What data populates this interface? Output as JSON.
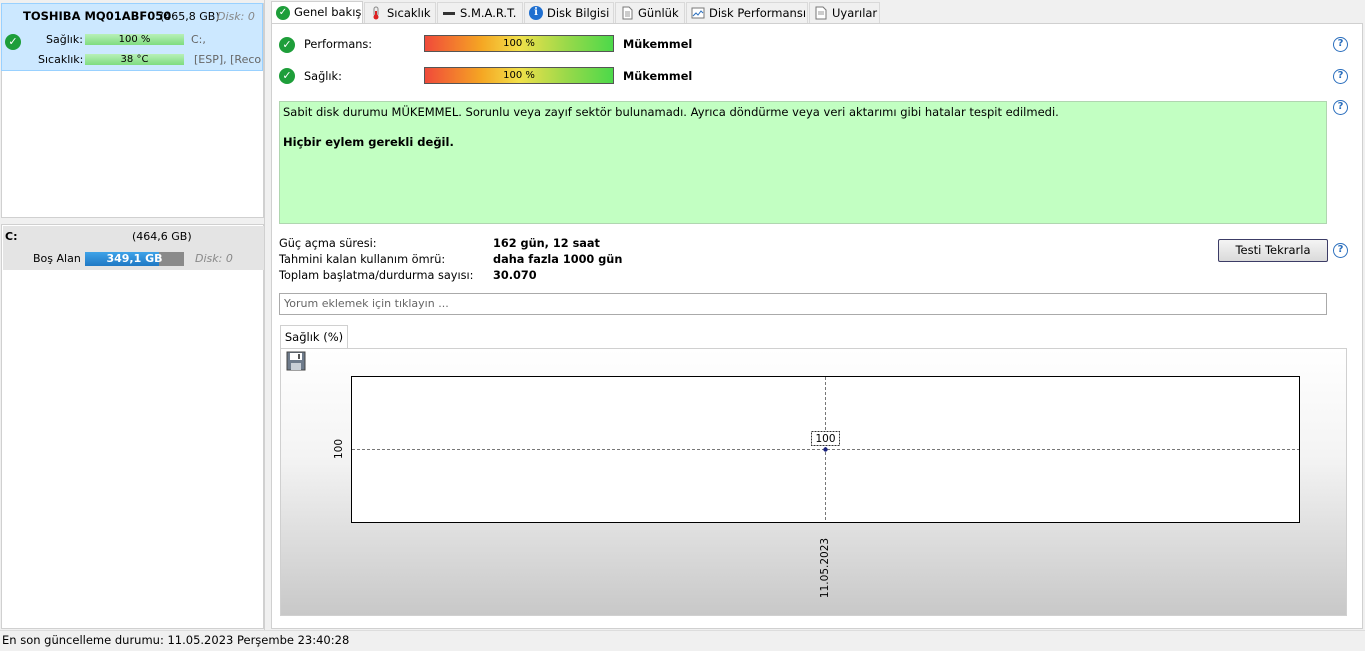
{
  "disk": {
    "name": "TOSHIBA MQ01ABF050",
    "size": "(465,8 GB)",
    "disk_index": "Disk: 0",
    "health_label": "Sağlık:",
    "health_value": "100 %",
    "health_fill": 1.0,
    "temp_label": "Sıcaklık:",
    "temp_value": "38 °C",
    "partitions": "C:,",
    "partitions_extra": "[ESP], [Reco"
  },
  "volume": {
    "letter": "C:",
    "size": "(464,6 GB)",
    "free_label": "Boş Alan",
    "free_value": "349,1 GB",
    "free_fill": 0.75,
    "disk_index": "Disk: 0"
  },
  "tabs": [
    {
      "label": "Genel bakış",
      "icon": "check-icon",
      "active": true
    },
    {
      "label": "Sıcaklık",
      "icon": "thermometer-icon"
    },
    {
      "label": "S.M.A.R.T.",
      "icon": "smart-icon"
    },
    {
      "label": "Disk Bilgisi",
      "icon": "info-icon"
    },
    {
      "label": "Günlük",
      "icon": "document-icon"
    },
    {
      "label": "Disk Performansı",
      "icon": "performance-icon"
    },
    {
      "label": "Uyarılar",
      "icon": "alerts-icon"
    }
  ],
  "overview": {
    "performance_label": "Performans:",
    "performance_value": "100 %",
    "performance_rating": "Mükemmel",
    "health_label": "Sağlık:",
    "health_value": "100 %",
    "health_rating": "Mükemmel",
    "status_text": "Sabit disk durumu MÜKEMMEL. Sorunlu veya zayıf sektör bulunamadı. Ayrıca döndürme veya veri aktarımı gibi hatalar tespit edilmedi.",
    "action_text": "Hiçbir eylem gerekli değil.",
    "power_on_label": "Güç açma süresi:",
    "power_on_value": "162 gün, 12 saat",
    "remaining_label": "Tahmini kalan kullanım ömrü:",
    "remaining_value": "daha fazla 1000 gün",
    "startstop_label": "Toplam başlatma/durdurma sayısı:",
    "startstop_value": "30.070",
    "retest_button": "Testi Tekrarla",
    "comment_placeholder": "Yorum eklemek için tıklayın ...",
    "help": "?"
  },
  "chart_tab_label": "Sağlık (%)",
  "chart_data": {
    "type": "line",
    "x": [
      "11.05.2023"
    ],
    "series": [
      {
        "values": [
          100
        ]
      }
    ],
    "ylabel": "",
    "xlabel": "",
    "ytick": "100",
    "point_label": "100",
    "grid": true
  },
  "statusbar": {
    "text": "En son güncelleme durumu: 11.05.2023 Perşembe 23:40:28"
  },
  "colors": {
    "selected_bg": "#cce8ff",
    "ok_green": "#1e9e3a",
    "status_bg": "#c2ffc2",
    "help_blue": "#2a6ebd",
    "free_bar": "#2f8fd8"
  }
}
